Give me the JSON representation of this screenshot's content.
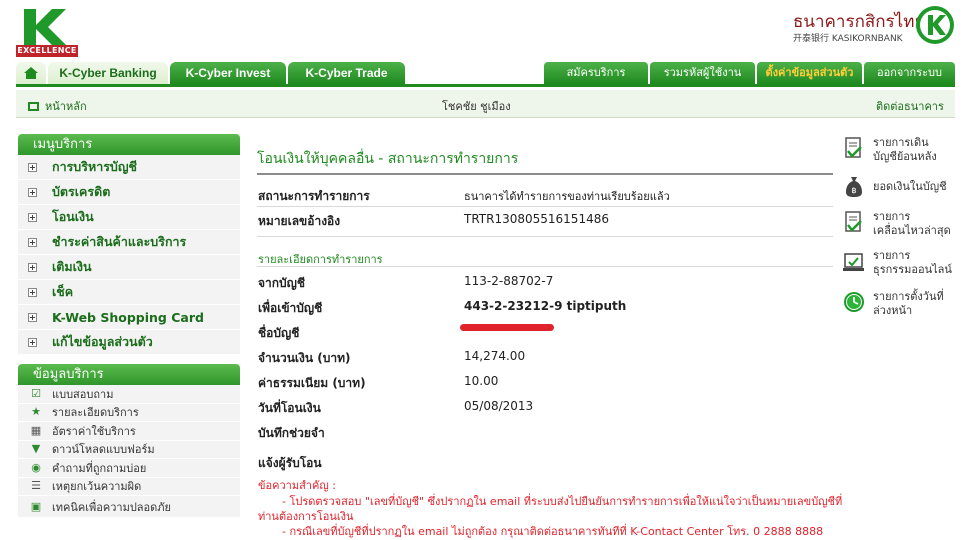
{
  "brand": {
    "logo_text": "EXCELLENCE",
    "bank_name_th": "ธนาคารกสิกรไทย",
    "bank_name_en": "开泰银行 KASIKORNBANK"
  },
  "tabs": [
    {
      "label": "K-Cyber Banking"
    },
    {
      "label": "K-Cyber Invest"
    },
    {
      "label": "K-Cyber Trade"
    }
  ],
  "right_tabs": [
    {
      "label": "สมัครบริการ"
    },
    {
      "label": "รวมรหัสผู้ใช้งาน"
    },
    {
      "label": "ตั้งค่าข้อมูลส่วนตัว"
    },
    {
      "label": "ออกจากระบบ"
    }
  ],
  "infobar": {
    "home": "หน้าหลัก",
    "user": "โชคชัย ชูเมือง",
    "contact": "ติดต่อธนาคาร"
  },
  "sidebar": {
    "menu_title": "เมนูบริการ",
    "menu_items": [
      "การบริหารบัญชี",
      "บัตรเครดิต",
      "โอนเงิน",
      "ชำระค่าสินค้าและบริการ",
      "เติมเงิน",
      "เช็ค",
      "K-Web Shopping Card",
      "แก้ไขข้อมูลส่วนตัว"
    ],
    "info_title": "ข้อมูลบริการ",
    "info_items": [
      {
        "label": "แบบสอบถาม",
        "icon": "checkbox-icon"
      },
      {
        "label": "รายละเอียดบริการ",
        "icon": "star-icon"
      },
      {
        "label": "อัตราค่าใช้บริการ",
        "icon": "calculator-icon"
      },
      {
        "label": "ดาวน์โหลดแบบฟอร์ม",
        "icon": "download-icon"
      },
      {
        "label": "คำถามที่ถูกถามบ่อย",
        "icon": "question-icon"
      },
      {
        "label": "เหตุยกเว้นความผิด",
        "icon": "handshake-icon"
      },
      {
        "label": "เทคนิคเพื่อความปลอดภัย",
        "icon": "lock-icon"
      }
    ]
  },
  "main": {
    "title": "โอนเงินให้บุคคลอื่น - สถานะการทำรายการ",
    "status_label": "สถานะการทำรายการ",
    "status_value": "ธนาคารได้ทำรายการของท่านเรียบร้อยแล้ว",
    "ref_label": "หมายเลขอ้างอิง",
    "ref_value": "TRTR130805516151486",
    "section_title": "รายละเอียดการทำรายการ",
    "from_label": "จากบัญชี",
    "from_value": "113-2-88702-7",
    "to_label": "เพื่อเข้าบัญชี",
    "to_value": "443-2-23212-9 tiptiputh",
    "name_label": "ชื่อบัญชี",
    "amount_label": "จำนวนเงิน (บาท)",
    "amount_value": "14,274.00",
    "fee_label": "ค่าธรรมเนียม (บาท)",
    "fee_value": "10.00",
    "date_label": "วันที่โอนเงิน",
    "date_value": "05/08/2013",
    "memo_label": "บันทึกช่วยจำ",
    "notify_label": "แจ้งผู้รับโอน",
    "note_title": "ข้อความสำคัญ :",
    "note_line1": "- โปรดตรวจสอบ \"เลขที่บัญชี\" ซึ่งปรากฏใน email ที่ระบบส่งไปยืนยันการทำรายการเพื่อให้แน่ใจว่าเป็นหมายเลขบัญชีที่",
    "note_line2": "ท่านต้องการโอนเงิน",
    "note_line3": "- กรณีเลขที่บัญชีที่ปรากฏใน email ไม่ถูกต้อง กรุณาติดต่อธนาคารทันทีที่ K-Contact Center โทร. 0 2888 8888"
  },
  "quick_links": [
    {
      "line1": "รายการเดิน",
      "line2": "บัญชีย้อนหลัง",
      "icon": "statement-icon"
    },
    {
      "line1": "ยอดเงินในบัญชี",
      "line2": "",
      "icon": "money-bag-icon"
    },
    {
      "line1": "รายการ",
      "line2": "เคลื่อนไหวล่าสุด",
      "icon": "recent-transaction-icon"
    },
    {
      "line1": "รายการ",
      "line2": "ธุรกรรมออนไลน์",
      "icon": "online-transaction-icon"
    },
    {
      "line1": "รายการตั้งวันที่",
      "line2": "ล่วงหน้า",
      "icon": "clock-icon"
    }
  ],
  "colors": {
    "brand_green": "#1f8a1f",
    "alert_red": "#e0222b"
  }
}
